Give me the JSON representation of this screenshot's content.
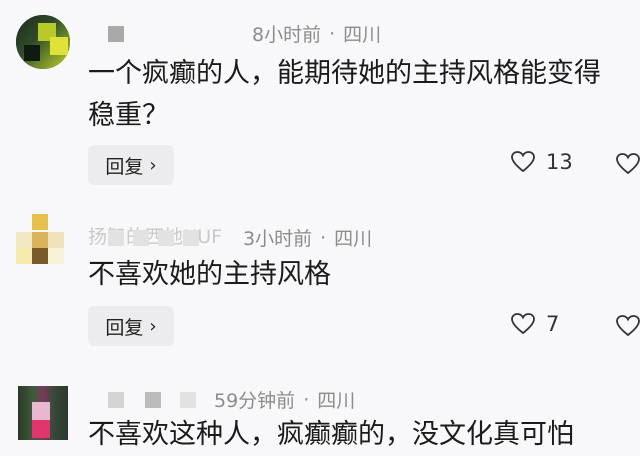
{
  "comments": [
    {
      "time": "8小时前",
      "location": "四川",
      "separator": "·",
      "text_lines": [
        "一个疯癫的人，能期待她的主持风格能变得",
        "稳重？"
      ],
      "reply_label": "回复",
      "like_count": "13"
    },
    {
      "name_fragment": "扬智的西地NUF",
      "time": "3小时前",
      "location": "四川",
      "separator": "·",
      "text_lines": [
        "不喜欢她的主持风格"
      ],
      "reply_label": "回复",
      "like_count": "7"
    },
    {
      "time": "59分钟前",
      "location": "四川",
      "separator": "·",
      "text_lines": [
        "不喜欢这种人，疯癫癫的，没文化真可怕"
      ]
    }
  ],
  "icons": {
    "like": "heart-outline-icon",
    "reply_chevron": "chevron-right-icon"
  },
  "colors": {
    "background": "#f8f8fa",
    "meta_text": "#8c8c8c",
    "reply_bg": "#ececee"
  }
}
